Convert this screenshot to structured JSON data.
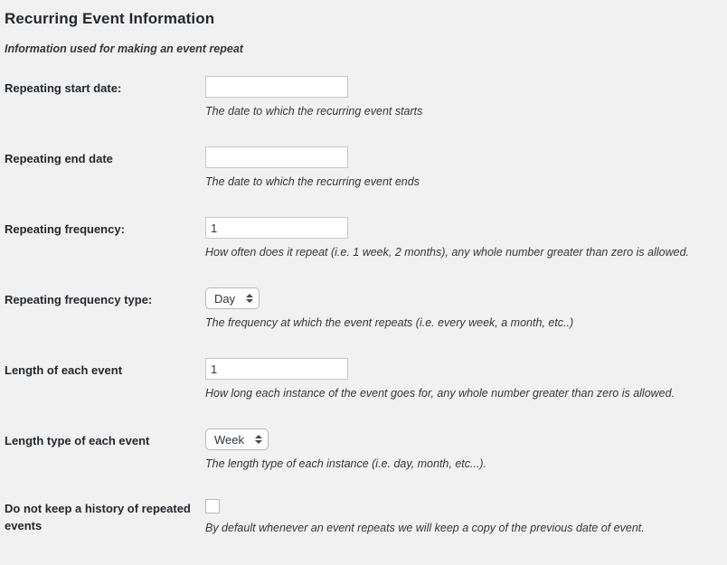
{
  "page": {
    "title": "Recurring Event Information",
    "subtitle": "Information used for making an event repeat"
  },
  "fields": [
    {
      "id": "repeating-start-date",
      "label": "Repeating start date:",
      "control": "text",
      "value": "",
      "description": "The date to which the recurring event starts"
    },
    {
      "id": "repeating-end-date",
      "label": "Repeating end date",
      "control": "text",
      "value": "",
      "description": "The date to which the recurring event ends"
    },
    {
      "id": "repeating-frequency",
      "label": "Repeating frequency:",
      "control": "text",
      "value": "1",
      "description": "How often does it repeat (i.e. 1 week, 2 months), any whole number greater than zero is allowed."
    },
    {
      "id": "repeating-frequency-type",
      "label": "Repeating frequency type:",
      "control": "select",
      "value": "Day",
      "description": "The frequency at which the event repeats (i.e. every week, a month, etc..)"
    },
    {
      "id": "length-of-each-event",
      "label": "Length of each event",
      "control": "text",
      "value": "1",
      "description": "How long each instance of the event goes for, any whole number greater than zero is allowed."
    },
    {
      "id": "length-type-of-each-event",
      "label": "Length type of each event",
      "control": "select",
      "value": "Week",
      "description": "The length type of each instance (i.e. day, month, etc...)."
    },
    {
      "id": "do-not-keep-history",
      "label": "Do not keep a history of repeated events",
      "control": "checkbox",
      "checked": false,
      "description": "By default whenever an event repeats we will keep a copy of the previous date of event."
    }
  ],
  "icons": {
    "stepper": "select-stepper-arrows-icon"
  },
  "colors": {
    "background": "#f1f1f1",
    "text": "#23282d",
    "input_border": "#c7c7c7",
    "select_border": "#b9b9b9",
    "checkbox_border": "#b4b9be"
  }
}
